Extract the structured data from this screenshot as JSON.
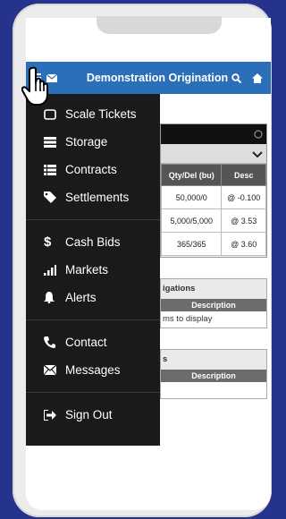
{
  "topbar": {
    "title": "Demonstration Origination"
  },
  "menu": {
    "group1": [
      {
        "label": "Scale Tickets",
        "icon": "scale-tickets-icon"
      },
      {
        "label": "Storage",
        "icon": "storage-icon"
      },
      {
        "label": "Contracts",
        "icon": "contracts-icon"
      },
      {
        "label": "Settlements",
        "icon": "tag-icon"
      }
    ],
    "group2": [
      {
        "label": "Cash Bids",
        "icon": "dollar-icon"
      },
      {
        "label": "Markets",
        "icon": "bar-chart-icon"
      },
      {
        "label": "Alerts",
        "icon": "bell-icon"
      }
    ],
    "group3": [
      {
        "label": "Contact",
        "icon": "phone-icon"
      },
      {
        "label": "Messages",
        "icon": "envelope-icon"
      }
    ],
    "group4": [
      {
        "label": "Sign Out",
        "icon": "sign-out-icon"
      }
    ]
  },
  "contracts_table": {
    "headers": [
      "Qty/Del (bu)",
      "Desc"
    ],
    "rows": [
      [
        "50,000/0",
        "@ -0.100"
      ],
      [
        "5,000/5,000",
        "@ 3.53"
      ],
      [
        "365/365",
        "@ 3.60"
      ]
    ]
  },
  "obligations": {
    "title": "igations",
    "header": "Description",
    "empty": "ms to display"
  },
  "second_box": {
    "title": "s",
    "header": "Description"
  },
  "colors": {
    "topbar": "#2a6fb8",
    "drawer": "#1a1a1a",
    "background": "#26338c"
  }
}
